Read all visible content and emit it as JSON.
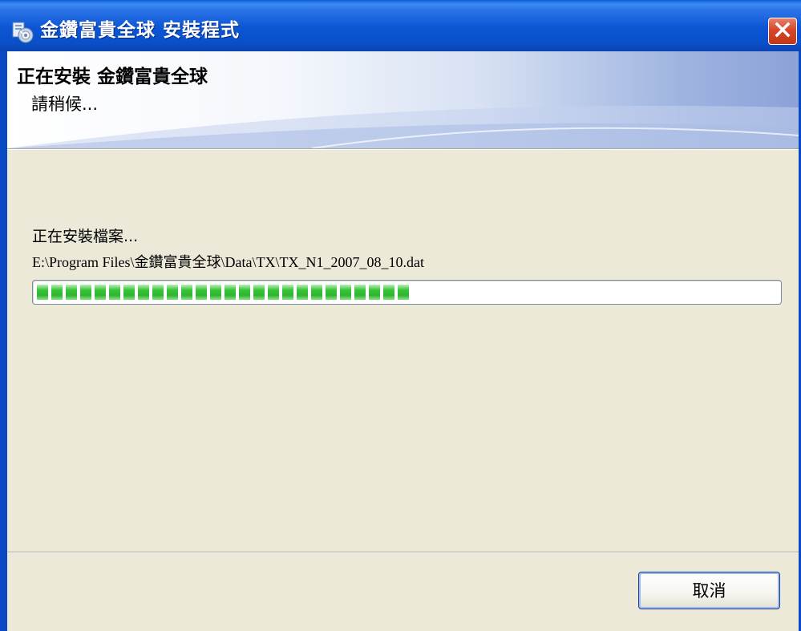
{
  "window": {
    "title": "金鑽富貴全球 安裝程式",
    "close_icon": "close-icon",
    "app_icon": "installer-disc-icon"
  },
  "header": {
    "title": "正在安裝 金鑽富貴全球",
    "subtitle": "請稍候..."
  },
  "body": {
    "status": "正在安裝檔案...",
    "current_file": "E:\\Program Files\\金鑽富貴全球\\Data\\TX\\TX_N1_2007_08_10.dat",
    "progress": 0.51
  },
  "footer": {
    "cancel_label": "取消"
  },
  "colors": {
    "titlebar": "#0b55d4",
    "progress_green": "#39c43a",
    "dialog_bg": "#ece9d8",
    "close_red": "#d8462a"
  }
}
